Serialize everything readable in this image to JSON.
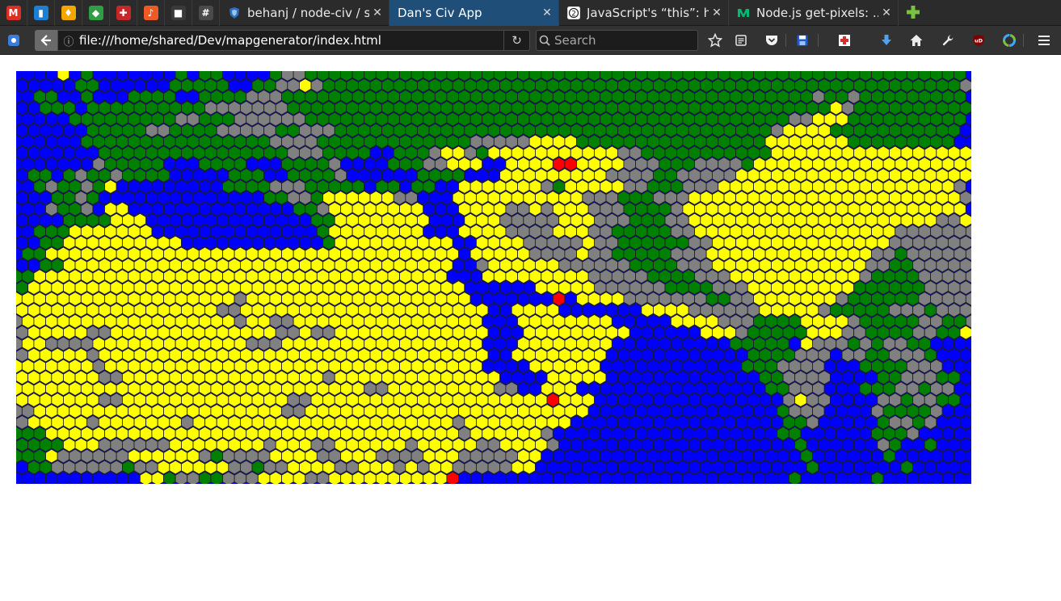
{
  "browser": {
    "pinned_tabs": [
      {
        "icon": "gmail-icon",
        "glyph": "M",
        "color": "#d93025"
      },
      {
        "icon": "trello-icon",
        "glyph": "▮",
        "color": "#1d7fd3"
      },
      {
        "icon": "keep-icon",
        "glyph": "♦",
        "color": "#f2a600"
      },
      {
        "icon": "gitlab-feed-icon",
        "glyph": "◆",
        "color": "#2f9e44"
      },
      {
        "icon": "medical-cross-icon",
        "glyph": "✚",
        "color": "#c62828"
      },
      {
        "icon": "music-icon",
        "glyph": "♪",
        "color": "#ef5a24"
      },
      {
        "icon": "dark-app-icon",
        "glyph": "■",
        "color": "#3a3a3a"
      },
      {
        "icon": "slack-hash-icon",
        "glyph": "#",
        "color": "#4a4a4a"
      }
    ],
    "tabs": [
      {
        "title": "behanj / node-civ / s...",
        "icon": "github-shield-icon",
        "active": false
      },
      {
        "title": "Dan's Civ App",
        "icon": "",
        "active": true
      },
      {
        "title": "JavaScript's “this”: h...",
        "icon": "numbered-2-icon",
        "active": false
      },
      {
        "title": "Node.js get-pixels: ...",
        "icon": "medium-icon",
        "active": false
      }
    ],
    "close_glyph": "✕",
    "new_tab_icon": "plus-icon",
    "url": "file:///home/shared/Dev/mapgenerator/index.html",
    "search_placeholder": "Search",
    "toolbar_icons": [
      "bookmark-star-icon",
      "reader-view-icon",
      "pocket-icon",
      "save-disk-icon",
      "medical-addon-icon",
      "download-arrow-icon",
      "home-icon",
      "wrench-icon",
      "ublock-icon",
      "color-wheel-icon",
      "hamburger-menu-icon"
    ]
  },
  "map": {
    "terrain_colors": {
      "water": "#0000ff",
      "grassland": "#008000",
      "hills": "#808080",
      "desert": "#ffff00",
      "city": "#ff0000"
    },
    "rows": [
      "WWWWDWGWWWWWWWGWGGWWWWGHHGGGGGGGGGGGGGGGGGGGGGGGGGGGGGGGGGGGGGGGGGGGGGGGGGGGGGGGG",
      "WWWWWGGWWWWWWGGGGGWWGGHHDHGGGGGGGGGGGGGGGGGGGGGGGGGGGGGGGGGGGGGGGGGGGGGGGGGGGGGGH",
      "WWGGWWGWWWGGGGWWGGGGHHHGGGGGGGGGGGGGGGGGGGGGGGGGGGGGGGGGGGGGGGGGGGGGHGGHGGGGGGGGG",
      "WWGGGWGGGGGGGGGGHHHHHHHGGGGGGGGGGGGGGGGGGGGGGGGGGGGGGGGGGGGGGGGGGGGGGDHGGGGGGGGGG",
      "WWWWWGGGGGGGGGHHGGGHHHHHHGGGGGGGGGGGGGGGGGGGGGGGGGGGGGGGGGGGGGGGGGHHDDDGGGGGGGGGG",
      "WWWWWWGGGGGHHGGGGHHHHHGGHHHGGGGGGGGGGGGGGGGGGGGGGGGGGGGGGGGGGGGGHDDDDGGGGGGGGGGG",
      "WWWWWWGGGGGGGGGGGGGGGGHHHHGGGGGGGGGGGGGHHHHHDDDDGGGGGGGGGGGGGGGGDDDDDDDGGGGGGGGG",
      "WWWWWWWGGGGGGGGGGGGGGGGHHHGGGGWWGGGHDDHGDDDDDDDDDDDHHGGGGGGGGGGGDDDDDDDDDDDDDDDDD",
      "WWWWWWWHGGGGGWWWGGGGWWWGGGGHWWWWGGGHHDDDWWDDDDRRDDDDHHHGGGHHHHGDDDDDDDDDDDDDDDDDDD",
      "WGGWGHGGHGGGGWWWWWGGGWWGGGGHWWWWWWGGGGWWWDDDDDDDDDHHHHGGHHHHHDDDDDDDDDDDDDDDDDDDD",
      "WWGHGGHGDWWWWWWWWWGGGGHHHGGGGGWGGWGGWWDDDDDDDHGDDDDDHHGGGHHHDDDDDDDDDDDDDDDDDDDDH",
      "WWWGGHGWWWWWWWWWWWWWWGGHHGDDDDDDHHWWWDDDDDDDDDDDHHHGGGHHHDDDDDDDDDDDDDDDDDDDDDDDH",
      "WWWHGGHWDDWWWWWWWWWWWWWWGGHDDDDDDDDWWWDDDDHHDHDDDHHHGGGGHDDDDDDDDDDDDDDDDDDDDDDDD",
      "WWWWGGGGDDDWWWWWWWWWWWWWWGGDDDDDDDDWWWDDDHHHHHDDDHHHGGGHHDDDDDDDDDDDDDDDDDDDDDHHDD",
      "WWGGGDDDDDDDWWWWWWWWWWWWWWGDDDDDDDDWWWDDDDHHHHDDDHHGGGGGHHDDDDDDDDDDDDDDDDDHHHHHHH",
      "WWGGDDDDDDDDDDWWWWWWWWWWWWGDDDDDDDDDDWWDDDDHHHHHDHHGGGGGGHHDDDDDDDDDDDDDDDHHHHHHHH",
      "WGGDDDDDDDDDDDDDDDDDDDDDDDDDDDDDDDDDDDWDDDDDHHHHDHHGGGGGHHHDDDDDDDDDDDDDDHHGHHHHHH",
      "WWGGDDDDDDDDDDDDDDDDDDDDDDDDDDDDDDDDDWWHDDDDDDHHHHHHGGGGHHHDDDDDDDDDDDDDHHGGHHHHHH",
      "GGDDDDDDDDDDDDDDDDDDDDDDDDDDDDDDDDDDDWWWDDDDDDDDDHHHHHGGGGHHHDDDDDDDDDDDHGGGGHHHHH",
      "GDDDDDDDDDDDDDDDDDDDDDDDDDDDDDDDDDDDDDWWWWWWDDDDDHHHHHHGGGGHHHDDDDDDDDDGGGGGGHHHHH",
      "DDDDDDDDDDDDDDDDDDDHDDDDDDDDDDDDDDDDDDDWWWWWWWRWDDDDHHHHHHHGGHHDDDDDDDHGGGGGGHHHHH",
      "DDDDDDDDDDDDDDDDDHHDDDDDDDDDDDDDDDDDDDDDWWDDDDWWWWWWWDDDDHHHHHHDDDDDHGGGGGHHHGHHHH",
      "HDDDDDDDDDDDDDDDDDDHDDHHDDDDDDDDDDDDDDDDWWWDDDDDDDDWWWWWDDDDHHHGGGGDDDDHGGGGGHHGGHD",
      "HDDDDDHHDDDDDDDDDDDDDDHHDHHDDDDDDDDDDDDDWWWDDDDDDDDDWWWWWWDDDHGGGGGDDDHHGGGGHHGGDHH",
      "HDDHHHHDDDDDDDDDDDDDHHHDDDDDDDDDDDDDDDDDWWWDDDDDDDDWWWWWWWWWWGGGGGWDHHHGHGHHGGWWWWW",
      "HDDDDDHDDDDDDDDDDDDDDDDDDDDDDDDDDDDDDDDDWWDDDDDDDDWWWWWWWWWWWWGGGGHHHWHHGGHHHGWWWWW",
      "DDDDDDDHDDDDDDDDDDDDDDDDDDDDDDDDDDDDDDDDWWWWDDDDDDWWWWWWWWWWWWGGGHHHHWWWGGGGHHHWWWG",
      "DDDDDDDHHDDDDDDDDDDDDDDDDDHDDDDDDDDDDDDDDWWWWDDDDDWWWWWWWWWWWWWGGHHHHWWWWGGHHHGGWWW",
      "DDDDDDDDDDDDDDDDDDDDDDDDDDDDDDHHDDDDDDDDDHHWWDDDWWWWWWWWWWWWWWWWGGHHHWWWGGGHHGHHWWW",
      "DDDDDDDHHDDDDDDDDDDDDDDHHDDDDDDDDDDDDDDDDDDDDRDDDWWWWWWWWWWWWWWWWHDHHWWWWHHGHHGGWWW",
      "HHDDDDDDDDDDDDDDDDDDDDDHHDDDDDDDDDDDDDDDDDDDDDDDDWWWWWWWWWWWWWWWWGHHHWWWWHGGGGHWWWW",
      "HDDDDDHDDDDDDDHDDDDDDDDDDDDDDDDDDDDDDHDDDDDDDDDWWWWWWWWWWWWWWWWWWGGHWWWWWGHHGHWWWWW",
      "GGGDDDDDDDDDDDDDDDDDDDDDDDDDDDDDDDDDDDHDDDDDDHWWWWWWWWWWWWWWWWWWWGGWWWWWWGGGHWWWWWW",
      "GGGGDDDHHHHHHDDDDDDDDHDDDHHDDDDDDHDDDDDHHDDDDHWWWWWWWWWWWWWWWWWWWWGWWWWWWHGWWGWWWWW",
      "GGGDHHHHHHDDDDDDHGHHHHDDDDHHDDDHHHHDDDHHHHHDDWWWWWWWWWWWWWWWWWWWWWWGWWWWWWGWWWWWWWW",
      "WGGHHHHHHGHHDDDDDDHHGHHDDDDHHDDDHDHDDHHHHHDDWWWWWWWWWWWWWWWWWWWWWWWGWWWWWWWGWWWWWWW",
      "WWWWWWWWWWWDDGHHGGHHHDDDDHHDDDDDDDDDDRWWWWWWWWWWWWWWWWWWWWWWWWWWWWGWWWWWWGWWWWWWW"
    ]
  }
}
